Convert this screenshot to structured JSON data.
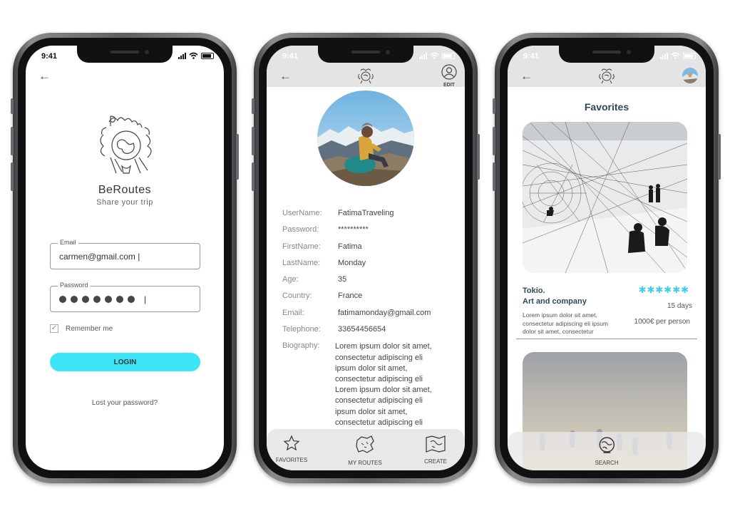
{
  "colors": {
    "accent": "#3ce6f7",
    "heading": "#2f4858",
    "stars": "#3ccfe8",
    "header_bar": "#e4e4e4"
  },
  "login": {
    "status_time": "9:41",
    "brand_name": "BeRoutes",
    "tagline": "Share your trip",
    "email": {
      "label": "Email",
      "value": "carmen@gmail.com |"
    },
    "password": {
      "label": "Password",
      "caret": "|"
    },
    "remember_label": "Remember me",
    "remember_checked": true,
    "login_button": "LOGIN",
    "lost_password": "Lost your password?"
  },
  "profile": {
    "status_time": "9:41",
    "edit_label": "EDIT",
    "fields": [
      {
        "label": "UserName:",
        "value": "FatimaTraveling"
      },
      {
        "label": "Password:",
        "value": "**********"
      },
      {
        "label": "FirstName:",
        "value": "Fatima"
      },
      {
        "label": "LastName:",
        "value": "Monday"
      },
      {
        "label": "Age:",
        "value": "35"
      },
      {
        "label": "Country:",
        "value": "France"
      },
      {
        "label": "Email:",
        "value": "fatimamonday@gmail.com"
      },
      {
        "label": "Telephone:",
        "value": "33654456654"
      }
    ],
    "biography_label": "Biography:",
    "biography_lines": [
      "Lorem ipsum dolor sit amet,",
      "consectetur adipiscing eli",
      "ipsum dolor sit amet,",
      "consectetur adipiscing eli",
      "Lorem ipsum dolor sit amet,",
      "consectetur adipiscing eli",
      "ipsum dolor sit amet,",
      "consectetur adipiscing eli"
    ],
    "nav": {
      "favorites": "FAVORITES",
      "my_routes": "MY ROUTES",
      "create": "CREATE"
    }
  },
  "favorites": {
    "status_time": "9:41",
    "title": "Favorites",
    "card": {
      "title_line1": "Tokio.",
      "title_line2": "Art and company",
      "rating": 6,
      "duration": "15 days",
      "description_lines": [
        "Lorem ipsum dolor sit amet,",
        "consectetur adipiscing eli ipsum",
        "dolor sit amet, consectetur"
      ],
      "price": "1000€ per person"
    },
    "search_label": "SEARCH"
  }
}
